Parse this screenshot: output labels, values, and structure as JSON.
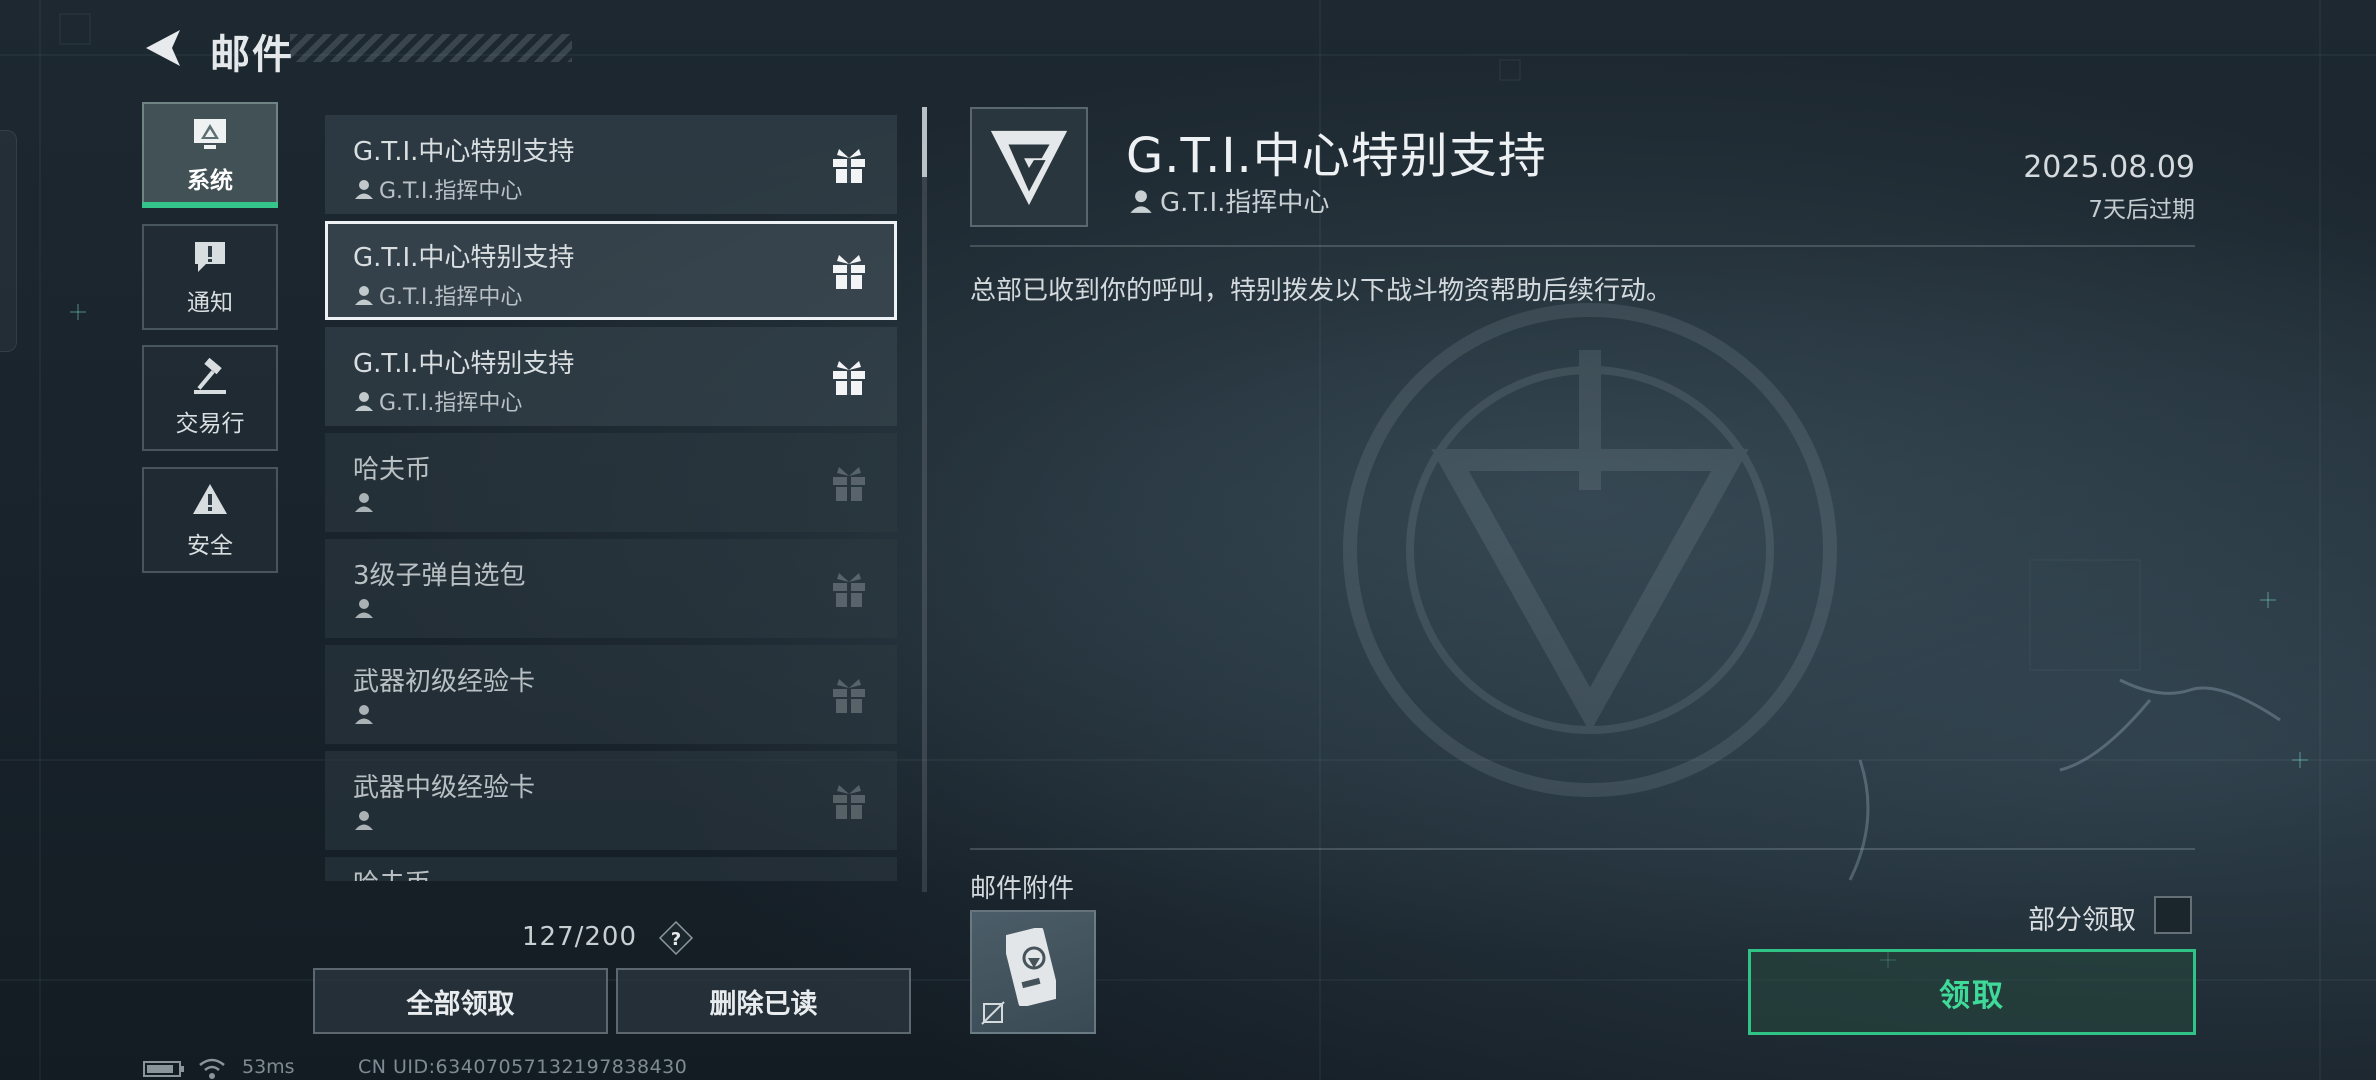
{
  "header": {
    "title": "邮件"
  },
  "categories": [
    {
      "label": "系统",
      "active": true
    },
    {
      "label": "通知"
    },
    {
      "label": "交易行"
    },
    {
      "label": "安全"
    }
  ],
  "mail_list": {
    "items": [
      {
        "title": "G.T.I.中心特别支持",
        "sender": "G.T.I.指挥中心"
      },
      {
        "title": "G.T.I.中心特别支持",
        "sender": "G.T.I.指挥中心"
      },
      {
        "title": "G.T.I.中心特别支持",
        "sender": "G.T.I.指挥中心"
      },
      {
        "title": "哈夫币",
        "sender": ""
      },
      {
        "title": "3级子弹自选包",
        "sender": ""
      },
      {
        "title": "武器初级经验卡",
        "sender": ""
      },
      {
        "title": "武器中级经验卡",
        "sender": ""
      },
      {
        "title": "哈夫币",
        "sender": ""
      }
    ],
    "selected_index": 1,
    "count": "127/200",
    "help_glyph": "?",
    "claim_all_label": "全部领取",
    "delete_read_label": "删除已读"
  },
  "status_bar": {
    "ping": "53ms",
    "uid": "CN UID:6340705713219783843​0"
  },
  "detail": {
    "title": "G.T.I.中心特别支持",
    "sender": "G.T.I.指挥中心",
    "date": "2025.08.09",
    "expire": "7天后过期",
    "body": "总部已收到你的呼叫，特别拨发以下战斗物资帮助后续行动。",
    "attachments_label": "邮件附件",
    "partial_claim_label": "部分领取",
    "claim_label": "领取"
  },
  "colors": {
    "accent_green": "#35c48a",
    "claim_text": "#3fd99a"
  }
}
